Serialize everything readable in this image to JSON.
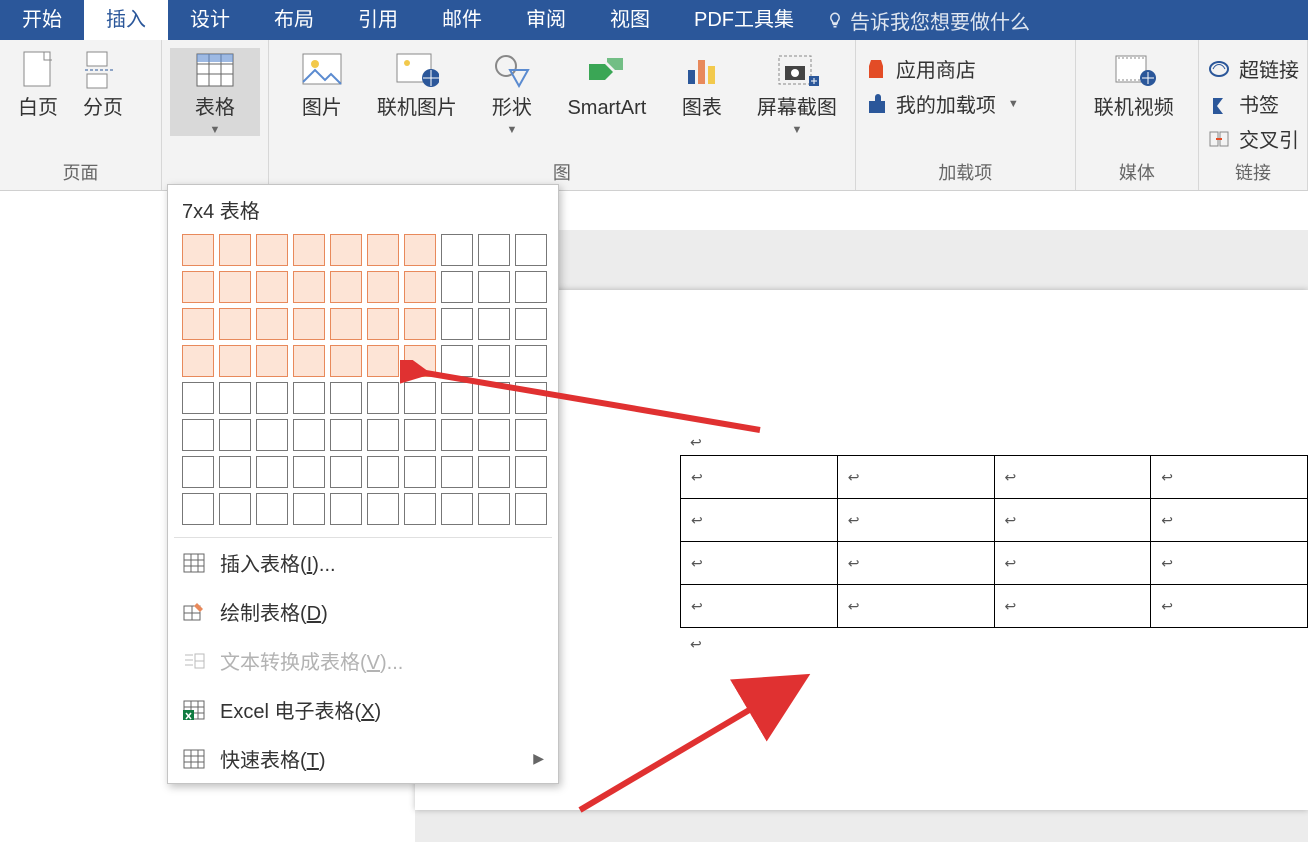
{
  "tabs": {
    "start": "开始",
    "insert": "插入",
    "design": "设计",
    "layout": "布局",
    "references": "引用",
    "mail": "邮件",
    "review": "审阅",
    "view": "视图",
    "pdf": "PDF工具集",
    "tell": "告诉我您想要做什么"
  },
  "ribbon": {
    "pages": {
      "blank": "白页",
      "break": "分页",
      "title": "页面"
    },
    "table_btn": "表格",
    "illustrations": {
      "picture": "图片",
      "online_picture": "联机图片",
      "shapes": "形状",
      "smartart": "SmartArt",
      "chart": "图表",
      "screenshot": "屏幕截图",
      "title": "图"
    },
    "addins": {
      "store": "应用商店",
      "myaddins": "我的加载项",
      "title": "加载项"
    },
    "media": {
      "online_video": "联机视频",
      "title": "媒体"
    },
    "links": {
      "hyperlink": "超链接",
      "bookmark": "书签",
      "crossref": "交叉引",
      "title": "链接"
    }
  },
  "dropdown": {
    "header": "7x4 表格",
    "sel_cols": 7,
    "sel_rows": 4,
    "grid_cols": 10,
    "grid_rows": 8,
    "insert_pre": "插入表格(",
    "insert_key": "I",
    "insert_post": ")...",
    "draw_pre": "绘制表格(",
    "draw_key": "D",
    "draw_post": ")",
    "convert_pre": "文本转换成表格(",
    "convert_key": "V",
    "convert_post": ")...",
    "excel_pre": "Excel 电子表格(",
    "excel_key": "X",
    "excel_post": ")",
    "quick_pre": "快速表格(",
    "quick_key": "T",
    "quick_post": ")"
  },
  "document": {
    "cell_mark": "↩",
    "preview_rows": 4,
    "preview_cols": 4
  }
}
